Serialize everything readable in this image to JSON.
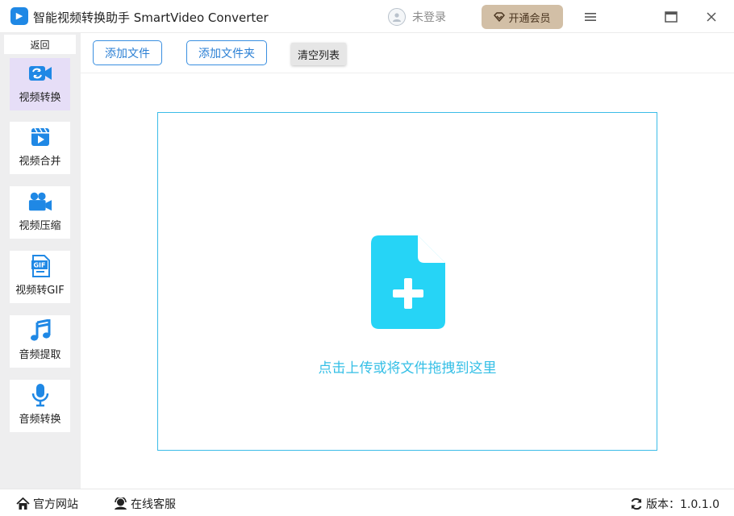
{
  "app": {
    "logo_text": "▶",
    "title": "智能视频转换助手 SmartVideo Converter"
  },
  "header": {
    "login_label": "未登录",
    "vip_label": "开通会员"
  },
  "sidebar": {
    "back_label": "返回",
    "items": [
      {
        "label": "视频转换",
        "icon": "video-convert-icon",
        "active": true
      },
      {
        "label": "视频合并",
        "icon": "video-merge-icon",
        "active": false
      },
      {
        "label": "视频压缩",
        "icon": "video-compress-icon",
        "active": false
      },
      {
        "label": "视频转GIF",
        "icon": "gif-icon",
        "active": false
      },
      {
        "label": "音频提取",
        "icon": "music-note-icon",
        "active": false
      },
      {
        "label": "音频转换",
        "icon": "microphone-icon",
        "active": false
      }
    ]
  },
  "toolbar": {
    "add_file_label": "添加文件",
    "add_folder_label": "添加文件夹",
    "clear_list_label": "清空列表"
  },
  "dropzone": {
    "hint": "点击上传或将文件拖拽到这里",
    "icon": "file-add-icon"
  },
  "footer": {
    "website_label": "官方网站",
    "service_label": "在线客服",
    "version_label": "版本：1.0.1.0"
  },
  "colors": {
    "accent_blue": "#2a7fd4",
    "drop_cyan": "#26d4f6",
    "active_nav": "#e6def7",
    "vip_gold": "#d2bfa6"
  }
}
